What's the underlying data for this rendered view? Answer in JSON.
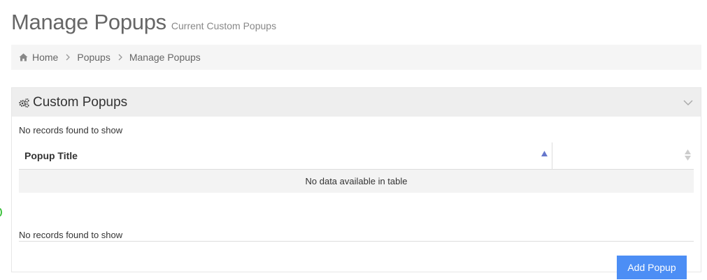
{
  "header": {
    "title": "Manage Popups",
    "subtitle": "Current Custom Popups"
  },
  "breadcrumb": {
    "icon": "home-icon",
    "items": [
      "Home",
      "Popups",
      "Manage Popups"
    ]
  },
  "portlet": {
    "icon": "cogs-icon",
    "title": "Custom Popups",
    "toggle_icon": "chevron-down-icon",
    "info_top": "No records found to show",
    "info_bottom": "No records found to show",
    "table": {
      "columns": [
        "Popup Title",
        ""
      ],
      "empty_message": "No data available in table"
    },
    "add_button": "Add Popup"
  },
  "colors": {
    "accent": "#4c8ef5",
    "sort_active": "#6677cc"
  }
}
